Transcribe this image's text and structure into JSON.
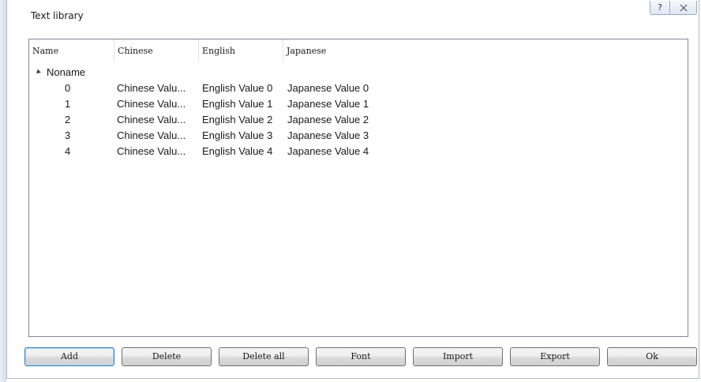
{
  "window": {
    "title": "Text library",
    "help_glyph": "?"
  },
  "list": {
    "columns": [
      "Name",
      "Chinese",
      "English",
      "Japanese"
    ],
    "root_label": "Noname",
    "rows": [
      {
        "name": "0",
        "chinese": "Chinese Valu...",
        "english": "English Value 0",
        "japanese": "Japanese Value 0"
      },
      {
        "name": "1",
        "chinese": "Chinese Valu...",
        "english": "English Value 1",
        "japanese": "Japanese Value 1"
      },
      {
        "name": "2",
        "chinese": "Chinese Valu...",
        "english": "English Value 2",
        "japanese": "Japanese Value 2"
      },
      {
        "name": "3",
        "chinese": "Chinese Valu...",
        "english": "English Value 3",
        "japanese": "Japanese Value 3"
      },
      {
        "name": "4",
        "chinese": "Chinese Valu...",
        "english": "English Value 4",
        "japanese": "Japanese Value 4"
      }
    ]
  },
  "buttons": {
    "add": "Add",
    "delete": "Delete",
    "delete_all": "Delete all",
    "font": "Font",
    "import": "Import",
    "export": "Export",
    "ok": "Ok"
  },
  "icons": {
    "help": "help-icon",
    "close": "close-icon",
    "expander": "expanded-triangle-icon"
  }
}
